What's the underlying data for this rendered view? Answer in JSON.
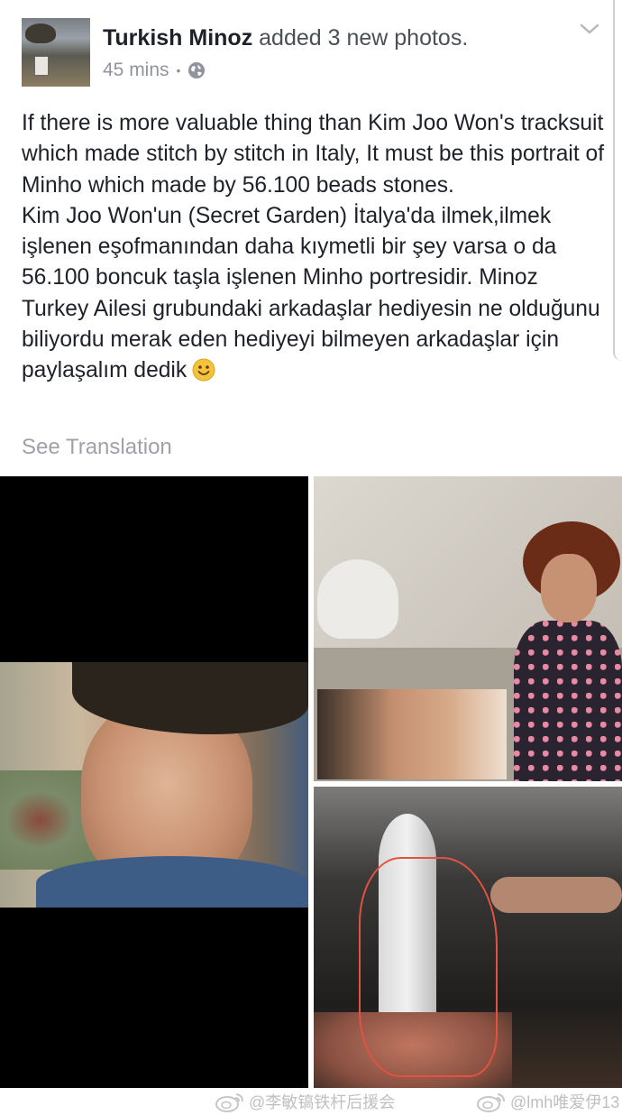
{
  "post": {
    "author": "Turkish Minoz",
    "action": "added 3 new photos.",
    "time": "45 mins",
    "separator": "•",
    "text_en": "If there is more valuable thing than Kim Joo Won's tracksuit which made stitch by stitch in Italy, It must be this portrait of Minho which made by 56.100 beads stones.",
    "text_tr": "Kim Joo Won'un (Secret Garden) İtalya'da ilmek,ilmek işlenen eşofmanından daha kıymetli bir şey varsa o da 56.100 boncuk taşla işlenen Minho portresidir. Minoz Turkey Ailesi grubundaki arkadaşlar hediyesin ne olduğunu biliyordu merak eden hediyeyi bilmeyen arkadaşlar için paylaşalım dedik",
    "see_translation": "See Translation"
  },
  "watermarks": {
    "left": "@李敏镐铁杆后援会",
    "right": "@lmh唯爱伊13"
  },
  "colors": {
    "text": "#1d2129",
    "meta": "#90949c",
    "link_gray": "#9ea2a8",
    "smiley": "#f5c33b"
  },
  "icons": {
    "privacy": "globe-icon",
    "menu": "chevron-down-icon",
    "emoji": "smiley-icon",
    "watermark": "weibo-icon"
  }
}
